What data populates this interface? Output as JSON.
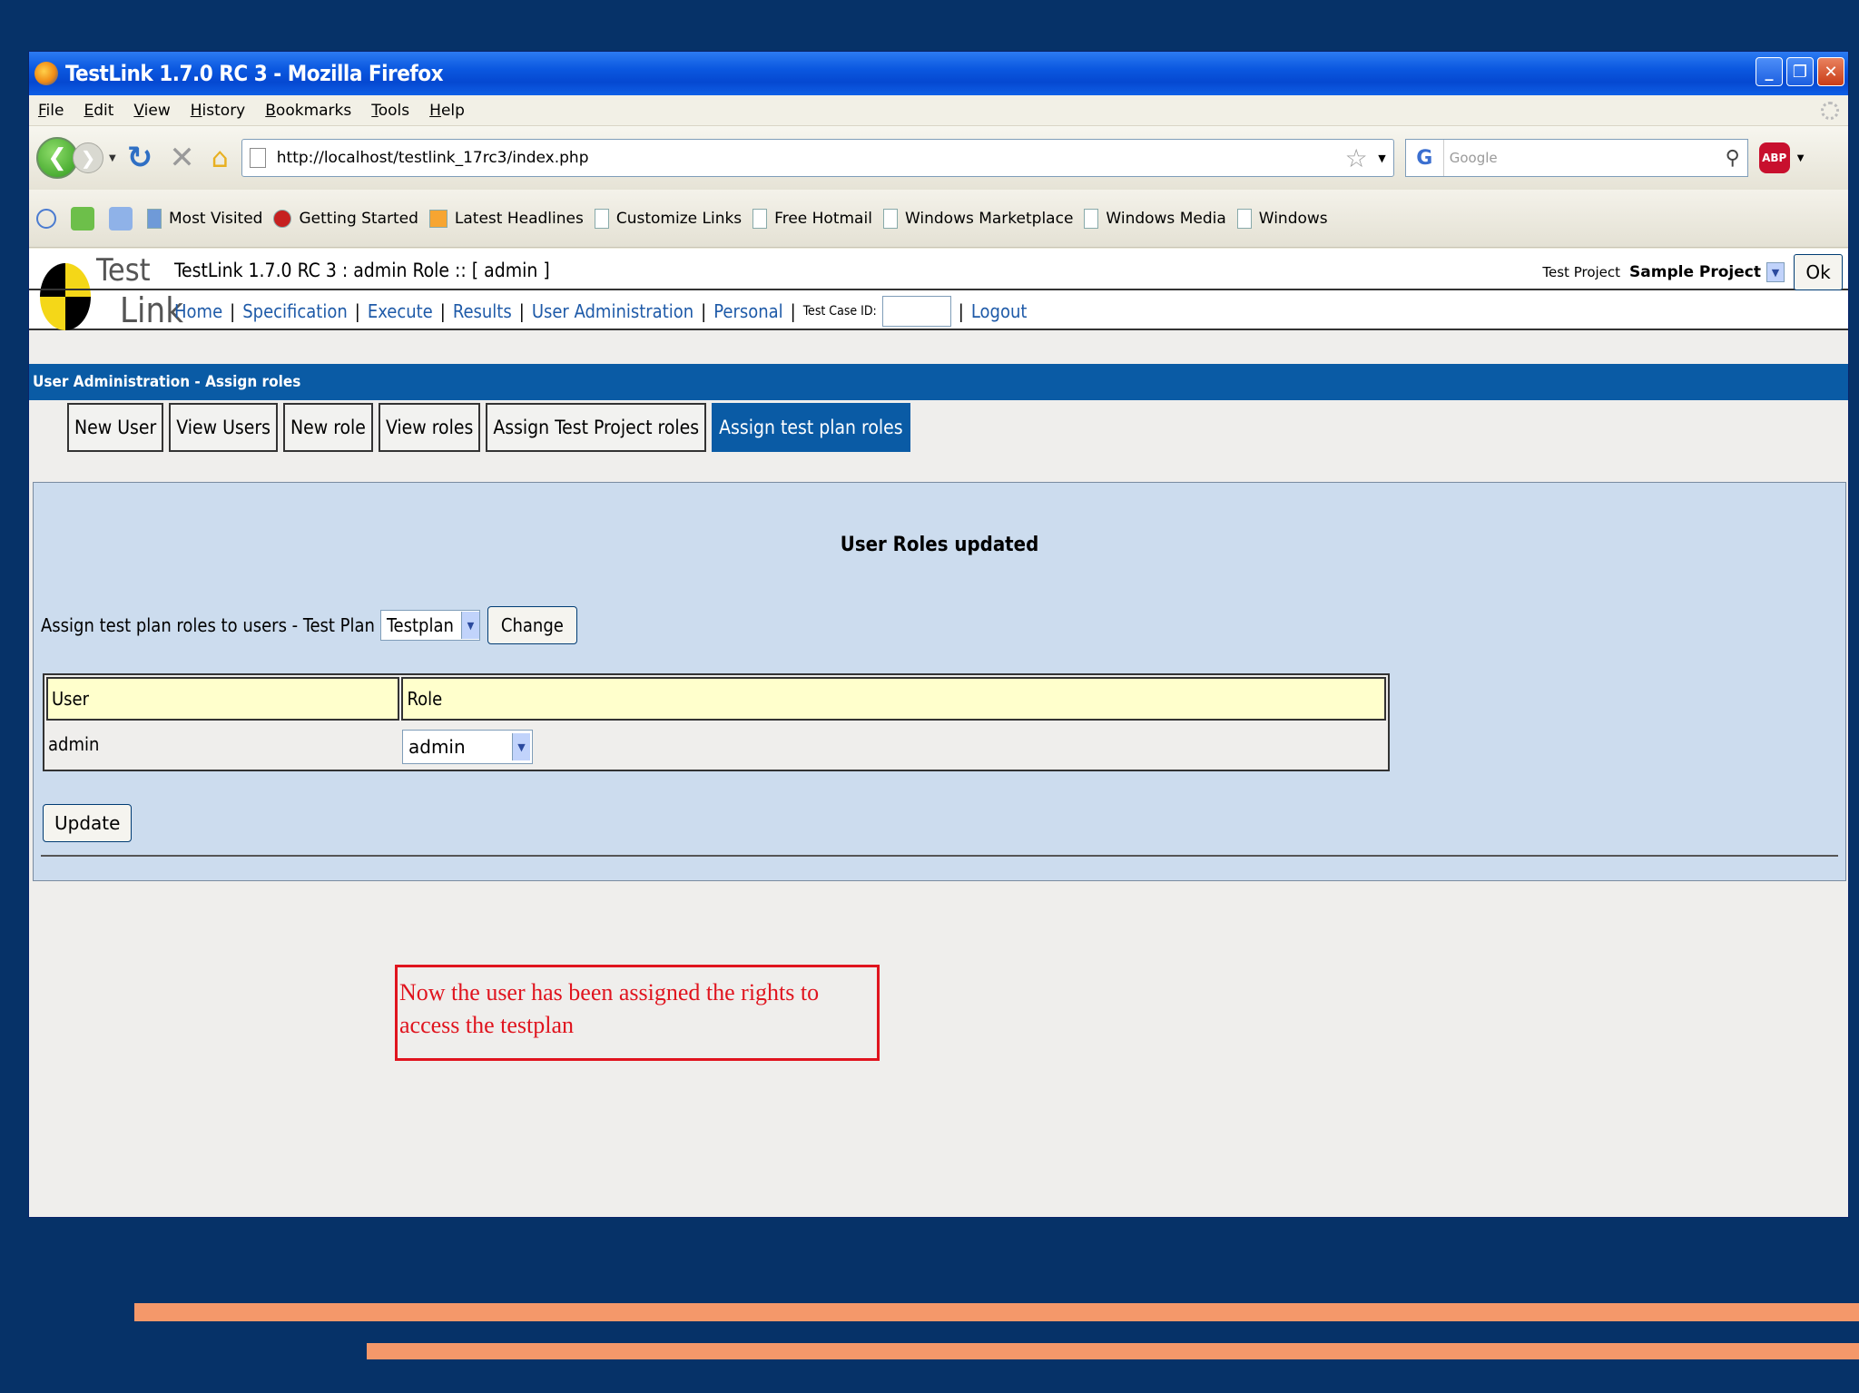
{
  "browser": {
    "title": "TestLink 1.7.0 RC 3 - Mozilla Firefox",
    "menu": [
      "File",
      "Edit",
      "View",
      "History",
      "Bookmarks",
      "Tools",
      "Help"
    ],
    "url": "http://localhost/testlink_17rc3/index.php",
    "search_placeholder": "Google",
    "bookmarks": [
      "Most Visited",
      "Getting Started",
      "Latest Headlines",
      "Customize Links",
      "Free Hotmail",
      "Windows Marketplace",
      "Windows Media",
      "Windows"
    ]
  },
  "testlink": {
    "logo_top": "Test",
    "logo_bottom": "Link",
    "title": "TestLink 1.7.0 RC 3 : admin Role :: [ admin ]",
    "nav": [
      "Home",
      "Specification",
      "Execute",
      "Results",
      "User Administration",
      "Personal"
    ],
    "test_case_label": "Test Case ID:",
    "logout": "Logout",
    "project_label": "Test Project",
    "project_value": "Sample Project",
    "ok_label": "Ok"
  },
  "page": {
    "section_title": "User Administration - Assign roles",
    "tabs": [
      "New User",
      "View Users",
      "New role",
      "View roles",
      "Assign Test Project roles",
      "Assign test plan roles"
    ],
    "active_tab": "Assign test plan roles",
    "message": "User Roles updated",
    "assign_label": "Assign test plan roles to users - Test Plan",
    "testplan_value": "Testplan",
    "change_label": "Change",
    "table": {
      "headers": [
        "User",
        "Role"
      ],
      "rows": [
        {
          "user": "admin",
          "role": "admin"
        }
      ]
    },
    "update_label": "Update"
  },
  "annotation": {
    "text": "Now the user has been assigned the rights to access the testplan"
  },
  "colors": {
    "slide_bg": "#063268",
    "stripe": "#f4986a",
    "section_bar": "#0a5ba5",
    "panel_bg": "#ccdcee",
    "table_header": "#ffffcc",
    "annotation_red": "#e0141e"
  }
}
